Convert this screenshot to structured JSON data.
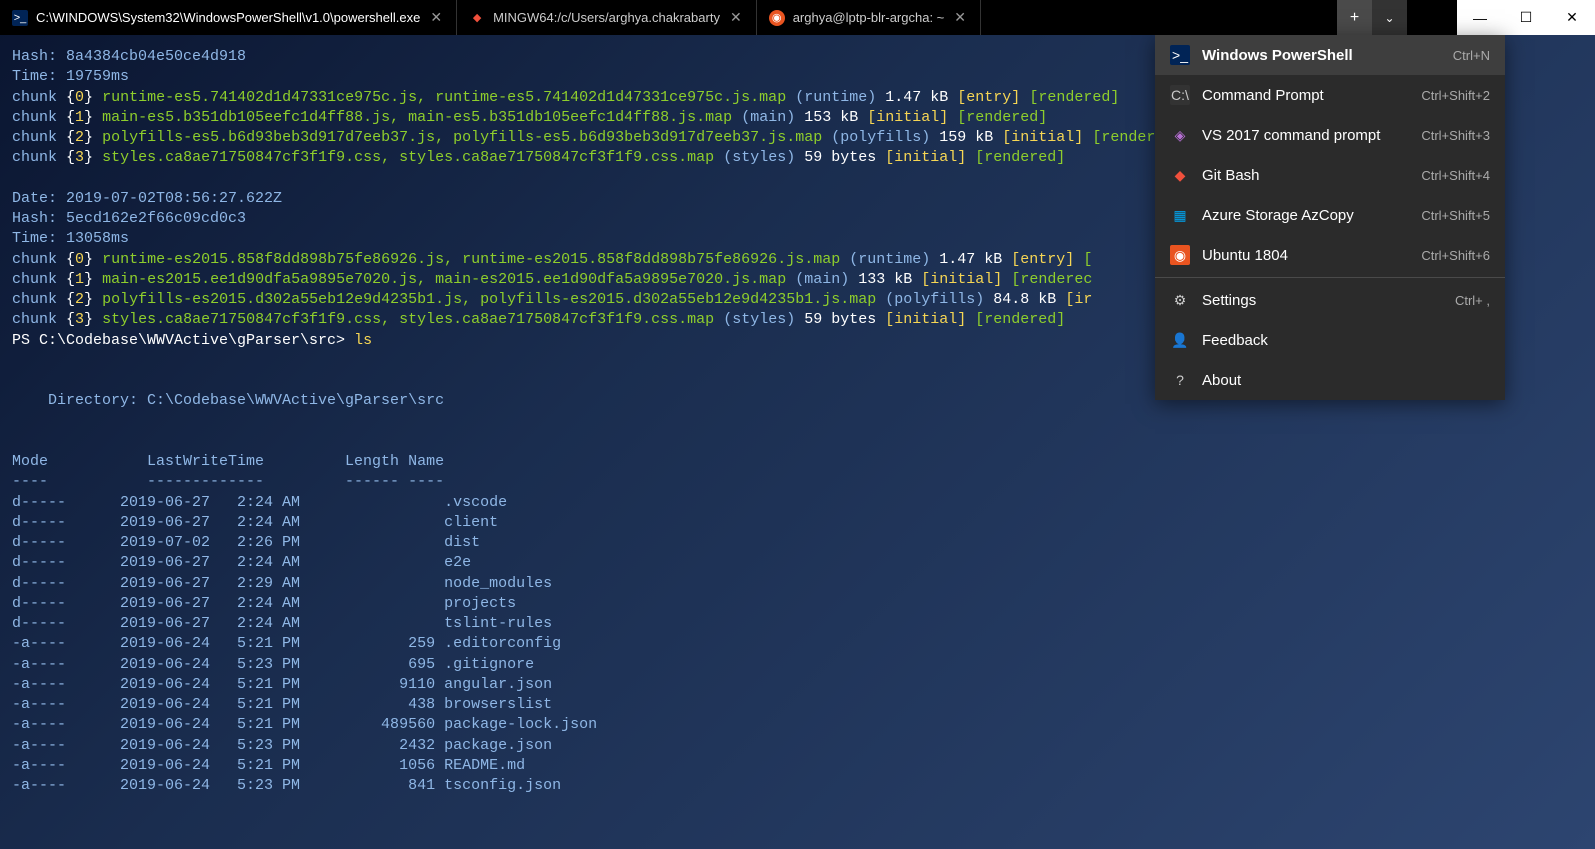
{
  "tabs": [
    {
      "label": "C:\\WINDOWS\\System32\\WindowsPowerShell\\v1.0\\powershell.exe",
      "icon": "ps"
    },
    {
      "label": "MINGW64:/c/Users/arghya.chakrabarty",
      "icon": "git"
    },
    {
      "label": "arghya@lptp-blr-argcha: ~",
      "icon": "ubuntu"
    }
  ],
  "menu": {
    "profiles": [
      {
        "label": "Windows PowerShell",
        "shortcut": "Ctrl+N",
        "icon": "ps",
        "selected": true
      },
      {
        "label": "Command Prompt",
        "shortcut": "Ctrl+Shift+2",
        "icon": "cmd"
      },
      {
        "label": "VS 2017 command prompt",
        "shortcut": "Ctrl+Shift+3",
        "icon": "vs"
      },
      {
        "label": "Git Bash",
        "shortcut": "Ctrl+Shift+4",
        "icon": "git"
      },
      {
        "label": "Azure Storage AzCopy",
        "shortcut": "Ctrl+Shift+5",
        "icon": "azure"
      },
      {
        "label": "Ubuntu 1804",
        "shortcut": "Ctrl+Shift+6",
        "icon": "ubuntu"
      }
    ],
    "actions": [
      {
        "label": "Settings",
        "shortcut": "Ctrl+ ,",
        "icon": "gear"
      },
      {
        "label": "Feedback",
        "shortcut": "",
        "icon": "feedback"
      },
      {
        "label": "About",
        "shortcut": "",
        "icon": "about"
      }
    ]
  },
  "term": {
    "hash1": "Hash: 8a4384cb04e50ce4d918",
    "time1": "Time: 19759ms",
    "chunks1": [
      {
        "idx": "0",
        "files": "runtime-es5.741402d1d47331ce975c.js, runtime-es5.741402d1d47331ce975c.js.map",
        "name": "(runtime)",
        "size": "1.47 kB",
        "flags_entry": "[entry]",
        "flags_rendered": "[rendered]"
      },
      {
        "idx": "1",
        "files": "main-es5.b351db105eefc1d4ff88.js, main-es5.b351db105eefc1d4ff88.js.map",
        "name": "(main)",
        "size": "153 kB",
        "flags_initial": "[initial]",
        "flags_rendered": "[rendered]"
      },
      {
        "idx": "2",
        "files": "polyfills-es5.b6d93beb3d917d7eeb37.js, polyfills-es5.b6d93beb3d917d7eeb37.js.map",
        "name": "(polyfills)",
        "size": "159 kB",
        "flags_initial": "[initial]",
        "flags_rendered_cut": "[rendere"
      },
      {
        "idx": "3",
        "files": "styles.ca8ae71750847cf3f1f9.css, styles.ca8ae71750847cf3f1f9.css.map",
        "name": "(styles)",
        "size": "59 bytes",
        "flags_initial": "[initial]",
        "flags_rendered": "[rendered]"
      }
    ],
    "date2": "Date: 2019-07-02T08:56:27.622Z",
    "hash2": "Hash: 5ecd162e2f66c09cd0c3",
    "time2": "Time: 13058ms",
    "chunks2": [
      {
        "idx": "0",
        "files": "runtime-es2015.858f8dd898b75fe86926.js, runtime-es2015.858f8dd898b75fe86926.js.map",
        "name": "(runtime)",
        "size": "1.47 kB",
        "flags_entry": "[entry]",
        "cut": "["
      },
      {
        "idx": "1",
        "files": "main-es2015.ee1d90dfa5a9895e7020.js, main-es2015.ee1d90dfa5a9895e7020.js.map",
        "name": "(main)",
        "size": "133 kB",
        "flags_initial": "[initial]",
        "flags_rendered_cut": "[renderec"
      },
      {
        "idx": "2",
        "files": "polyfills-es2015.d302a55eb12e9d4235b1.js, polyfills-es2015.d302a55eb12e9d4235b1.js.map",
        "name": "(polyfills)",
        "size": "84.8 kB",
        "flags_initial_cut": "[ir"
      },
      {
        "idx": "3",
        "files": "styles.ca8ae71750847cf3f1f9.css, styles.ca8ae71750847cf3f1f9.css.map",
        "name": "(styles)",
        "size": "59 bytes",
        "flags_initial": "[initial]",
        "flags_rendered": "[rendered]"
      }
    ],
    "prompt": "PS C:\\Codebase\\WWVActive\\gParser\\src>",
    "cmd": "ls",
    "dir_header": "    Directory: C:\\Codebase\\WWVActive\\gParser\\src",
    "cols": {
      "mode": "Mode",
      "lwt": "LastWriteTime",
      "length": "Length",
      "name": "Name"
    },
    "dashes": {
      "mode": "----",
      "lwt": "-------------",
      "length": "------",
      "name": "----"
    },
    "files": [
      {
        "mode": "d-----",
        "date": "2019-06-27",
        "time": "2:24 AM",
        "len": "",
        "name": ".vscode"
      },
      {
        "mode": "d-----",
        "date": "2019-06-27",
        "time": "2:24 AM",
        "len": "",
        "name": "client"
      },
      {
        "mode": "d-----",
        "date": "2019-07-02",
        "time": "2:26 PM",
        "len": "",
        "name": "dist"
      },
      {
        "mode": "d-----",
        "date": "2019-06-27",
        "time": "2:24 AM",
        "len": "",
        "name": "e2e"
      },
      {
        "mode": "d-----",
        "date": "2019-06-27",
        "time": "2:29 AM",
        "len": "",
        "name": "node_modules"
      },
      {
        "mode": "d-----",
        "date": "2019-06-27",
        "time": "2:24 AM",
        "len": "",
        "name": "projects"
      },
      {
        "mode": "d-----",
        "date": "2019-06-27",
        "time": "2:24 AM",
        "len": "",
        "name": "tslint-rules"
      },
      {
        "mode": "-a----",
        "date": "2019-06-24",
        "time": "5:21 PM",
        "len": "259",
        "name": ".editorconfig"
      },
      {
        "mode": "-a----",
        "date": "2019-06-24",
        "time": "5:23 PM",
        "len": "695",
        "name": ".gitignore"
      },
      {
        "mode": "-a----",
        "date": "2019-06-24",
        "time": "5:21 PM",
        "len": "9110",
        "name": "angular.json"
      },
      {
        "mode": "-a----",
        "date": "2019-06-24",
        "time": "5:21 PM",
        "len": "438",
        "name": "browserslist"
      },
      {
        "mode": "-a----",
        "date": "2019-06-24",
        "time": "5:21 PM",
        "len": "489560",
        "name": "package-lock.json"
      },
      {
        "mode": "-a----",
        "date": "2019-06-24",
        "time": "5:23 PM",
        "len": "2432",
        "name": "package.json"
      },
      {
        "mode": "-a----",
        "date": "2019-06-24",
        "time": "5:21 PM",
        "len": "1056",
        "name": "README.md"
      },
      {
        "mode": "-a----",
        "date": "2019-06-24",
        "time": "5:23 PM",
        "len": "841",
        "name": "tsconfig.json"
      }
    ]
  }
}
